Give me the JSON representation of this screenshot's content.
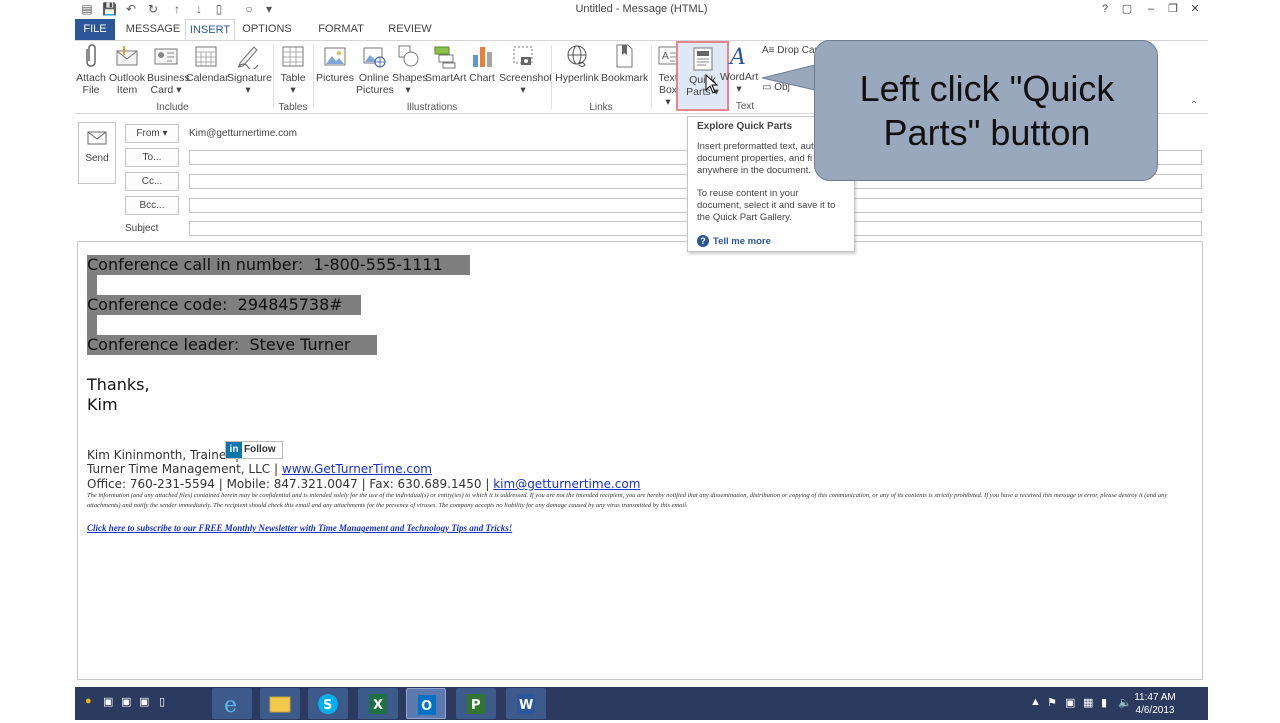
{
  "window": {
    "title": "Untitled - Message (HTML)",
    "controls": [
      "?",
      "▢",
      "–",
      "❐",
      "✕"
    ]
  },
  "tabs": [
    "FILE",
    "MESSAGE",
    "INSERT",
    "OPTIONS",
    "FORMAT TEXT",
    "REVIEW"
  ],
  "ribbon": {
    "include": {
      "label": "Include",
      "buttons": [
        {
          "line1": "Attach",
          "line2": "File"
        },
        {
          "line1": "Outlook",
          "line2": "Item"
        },
        {
          "line1": "Business",
          "line2": "Card ▾"
        },
        {
          "line1": "Calendar",
          "line2": ""
        },
        {
          "line1": "Signature",
          "line2": "▾"
        }
      ]
    },
    "tables": {
      "label": "Tables",
      "buttons": [
        {
          "line1": "Table",
          "line2": "▾"
        }
      ]
    },
    "illustrations": {
      "label": "Illustrations",
      "buttons": [
        {
          "line1": "Pictures",
          "line2": ""
        },
        {
          "line1": "Online",
          "line2": "Pictures"
        },
        {
          "line1": "Shapes",
          "line2": "▾"
        },
        {
          "line1": "SmartArt",
          "line2": ""
        },
        {
          "line1": "Chart",
          "line2": ""
        },
        {
          "line1": "Screenshot",
          "line2": "▾"
        }
      ]
    },
    "links": {
      "label": "Links",
      "buttons": [
        {
          "line1": "Hyperlink",
          "line2": ""
        },
        {
          "line1": "Bookmark",
          "line2": ""
        }
      ]
    },
    "text": {
      "label": "Text",
      "buttons": [
        {
          "line1": "Text",
          "line2": "Box ▾"
        },
        {
          "line1": "Quick",
          "line2": "Parts ▾"
        },
        {
          "line1": "WordArt",
          "line2": "▾"
        }
      ],
      "drop_cap": "Drop Cap",
      "obj": "Obj"
    }
  },
  "header": {
    "from_label": "From ▾",
    "from_value": "Kim@getturnertime.com",
    "to_label": "To...",
    "cc_label": "Cc...",
    "bcc_label": "Bcc...",
    "subject_label": "Subject",
    "send_label": "Send"
  },
  "tooltip": {
    "title": "Explore Quick Parts",
    "p1": "Insert preformatted text, auto document properties, and fi anywhere in the document.",
    "p2": "To reuse content in your document, select it and save it to the Quick Part Gallery.",
    "tell_more": "Tell me more"
  },
  "callout": {
    "line1": "Left click \"Quick",
    "line2": "Parts\" button"
  },
  "message": {
    "line1": "Conference call in number:  1-800-555-1111 ",
    "line2": "Conference code:  294845738# ",
    "line3": "Conference leader:  Steve Turner ",
    "thanks": "Thanks,",
    "name": "Kim",
    "sig_name": "Kim Kininmonth, Trainer  |",
    "follow": "Follow",
    "sig_company": "Turner Time Management, LLC |",
    "sig_site": "www.GetTurnerTime.com",
    "sig_phone": "Office:  760-231-5594 | Mobile:  847.321.0047 | Fax:  630.689.1450 |",
    "sig_email": "kim@getturnertime.com",
    "disclaimer": "The information (and any attached files) contained herein may be confidential and is intended solely for the use of the individual(s) or entity(ies) to which it is addressed.  If you are not the intended recipient, you are hereby notified that any dissemination, distribution or copying of this communication, or any of its contents is strictly prohibited.  If you have a received this message in error, please destroy it (and any attachments) and notify the sender immediately.  The recipient should check this email and any attachments for the presence of viruses.  The company accepts no liability for any damage caused by any virus transmitted by this email.",
    "newsletter": "Click here to subscribe to our FREE Monthly Newsletter with Time Management and Technology Tips and Tricks!"
  },
  "taskbar": {
    "time": "11:47 AM",
    "date": "4/6/2013"
  },
  "colors": {
    "accent": "#2b579a",
    "selection": "#7f7f7f",
    "callout": "#9aa8bd",
    "taskbar": "#2b3a5e"
  }
}
